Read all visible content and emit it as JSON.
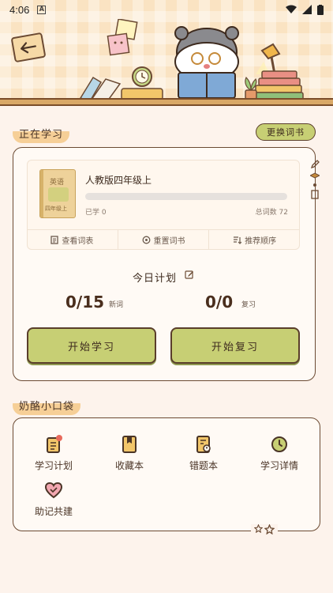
{
  "status_bar": {
    "time": "4:06",
    "badge": "A"
  },
  "header": {
    "back_label": "back-arrow-icon"
  },
  "studying": {
    "section_title": "正在学习",
    "change_book_label": "更换词书",
    "book": {
      "cover_title": "英语",
      "cover_subtitle": "四年级上",
      "title": "人教版四年级上",
      "learned_label": "已学 0",
      "total_label": "总词数 72",
      "progress_fraction": 0
    },
    "actions": [
      {
        "label": "查看词表",
        "icon": "list-icon"
      },
      {
        "label": "重置词书",
        "icon": "reset-icon"
      },
      {
        "label": "推荐顺序",
        "icon": "sort-icon"
      }
    ],
    "plan": {
      "title": "今日计划",
      "new_count": "0/15",
      "new_label": "新词",
      "review_count": "0/0",
      "review_label": "复习"
    },
    "start_learn_label": "开始学习",
    "start_review_label": "开始复习"
  },
  "pocket": {
    "section_title": "奶酪小口袋",
    "items": [
      {
        "label": "学习计划",
        "icon": "clipboard-icon"
      },
      {
        "label": "收藏本",
        "icon": "bookmark-icon"
      },
      {
        "label": "错题本",
        "icon": "mistake-book-icon"
      },
      {
        "label": "学习详情",
        "icon": "clock-icon"
      },
      {
        "label": "助记共建",
        "icon": "heart-icon"
      }
    ]
  },
  "colors": {
    "accent": "#c7cf74",
    "border": "#6b4a33",
    "background": "#fdf3ec"
  }
}
